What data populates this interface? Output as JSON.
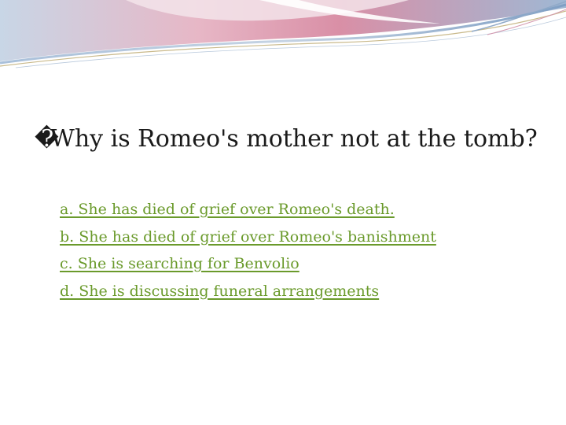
{
  "slide": {
    "question_bullet": "�",
    "question": "Why is Romeo's mother not at the tomb?",
    "answers": [
      "a. She has died of grief over Romeo's death.",
      "b. She has died of grief over Romeo's banishment",
      "c. She is searching for Benvolio",
      "d. She is discussing funeral arrangements"
    ]
  },
  "colors": {
    "answer_link": "#6a9a2b",
    "question_text": "#1a1a1a",
    "header_pink": "#d9a0b2",
    "header_blue": "#9fb8d4",
    "header_gold": "#c9b98a"
  }
}
